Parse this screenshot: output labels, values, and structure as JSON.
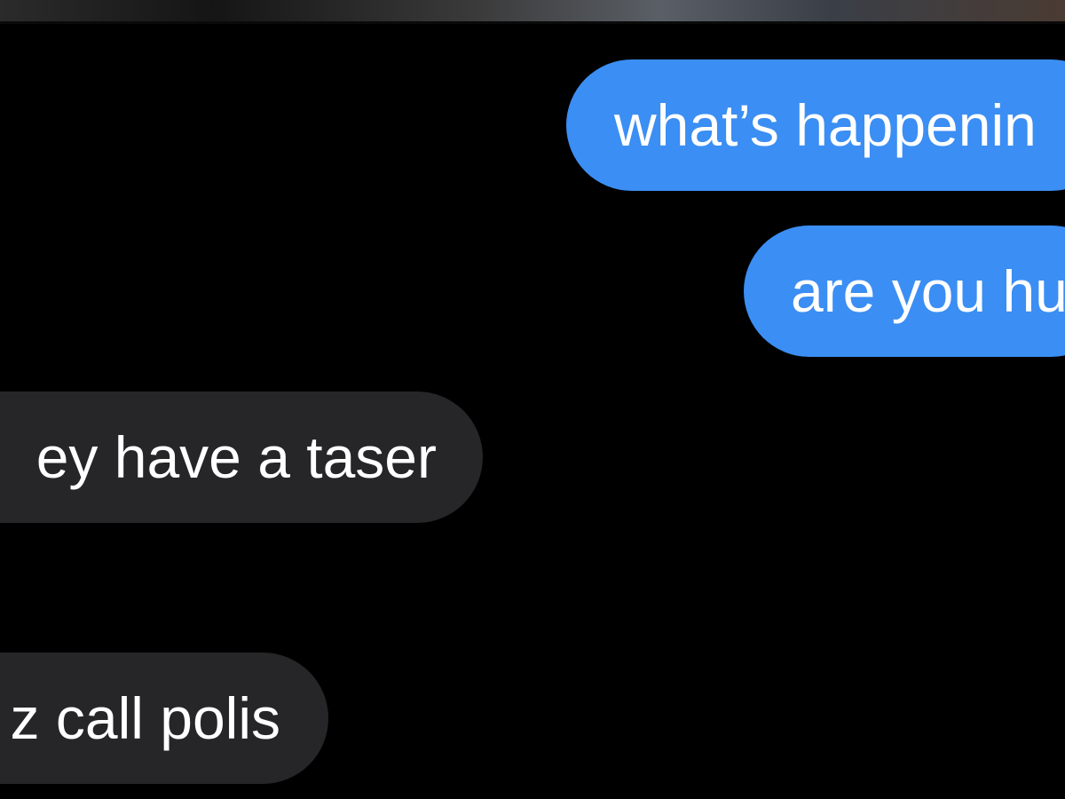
{
  "conversation": {
    "messages": [
      {
        "direction": "sent",
        "text": "what’s happenin"
      },
      {
        "direction": "sent",
        "text": "are you hu"
      },
      {
        "direction": "received",
        "text": "ey have a taser"
      },
      {
        "direction": "received",
        "text": "z call polis"
      }
    ]
  },
  "colors": {
    "background": "#000000",
    "sent_bubble": "#3b8ef3",
    "received_bubble": "#262628",
    "text": "#ffffff"
  }
}
